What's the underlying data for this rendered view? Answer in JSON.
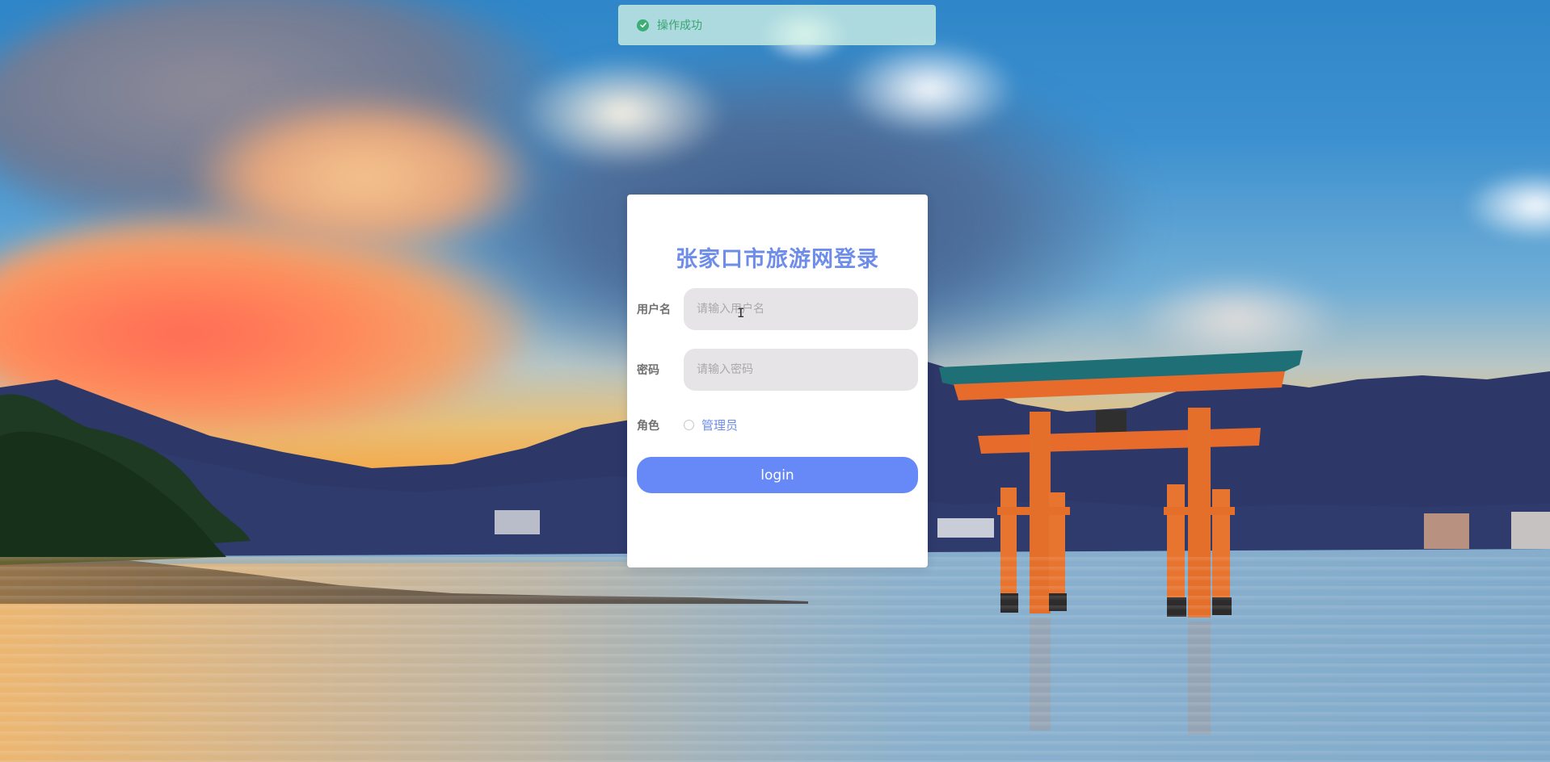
{
  "toast": {
    "message": "操作成功",
    "status_color": "#3cae76"
  },
  "login_form": {
    "title": "张家口市旅游网登录",
    "username": {
      "label": "用户名",
      "placeholder": "请输入用户名",
      "value": ""
    },
    "password": {
      "label": "密码",
      "placeholder": "请输入密码",
      "value": ""
    },
    "role": {
      "label": "角色",
      "options": [
        "管理员"
      ],
      "selected": null
    },
    "submit_label": "login",
    "accent_color": "#6789f7"
  }
}
